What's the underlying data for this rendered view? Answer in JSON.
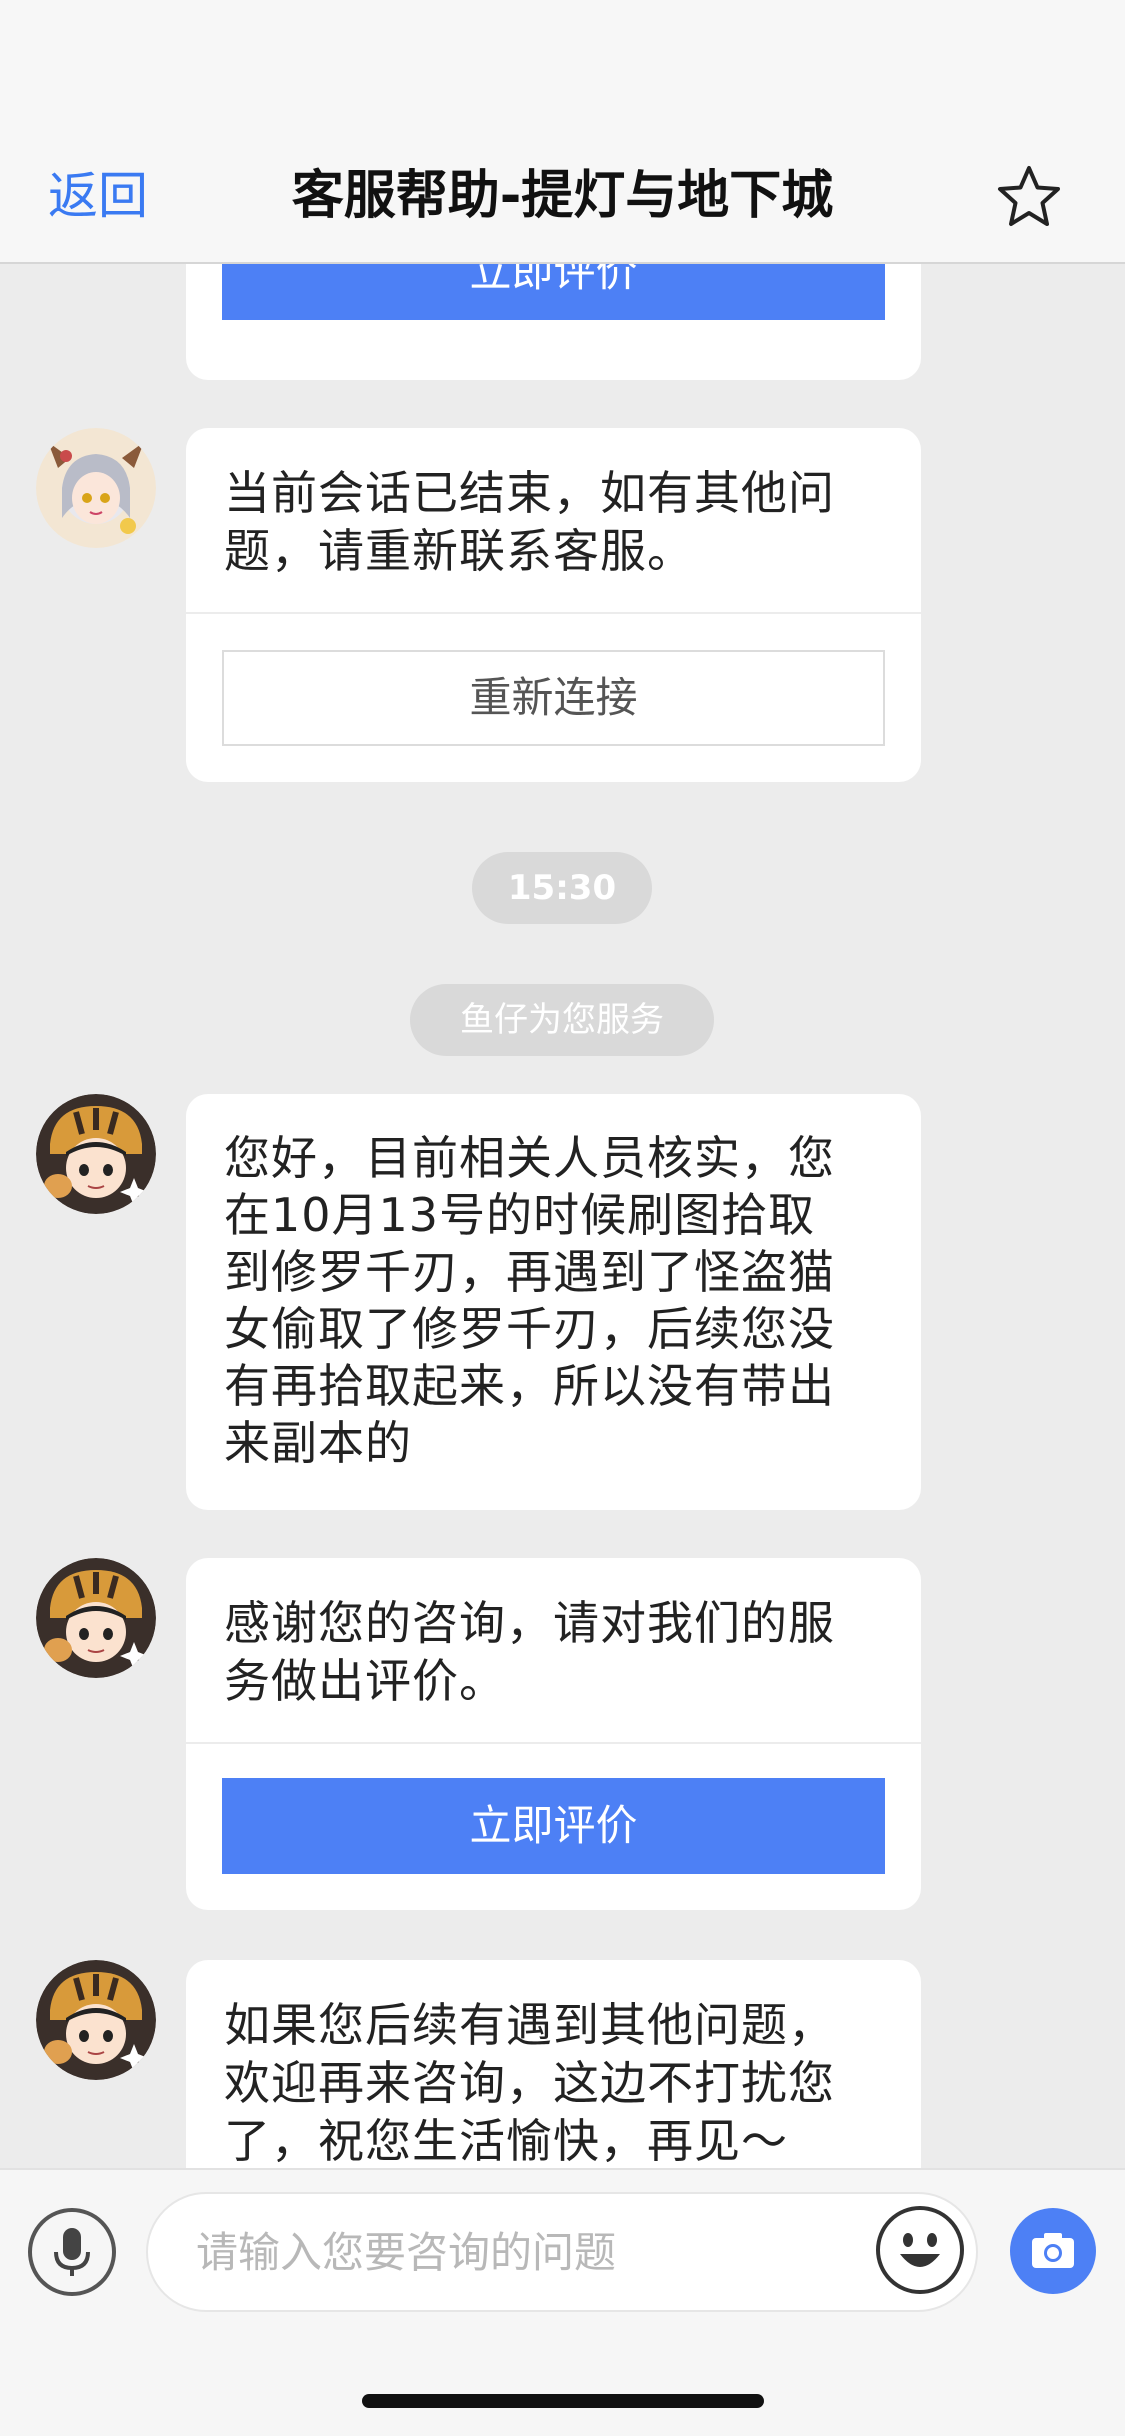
{
  "header": {
    "back_label": "返回",
    "title": "客服帮助-提灯与地下城",
    "favorite_icon": "star-icon"
  },
  "messages": [
    {
      "type": "rating_prompt_partial",
      "button_label": "立即评价"
    },
    {
      "type": "session_end",
      "avatar": "agent-avatar-girl",
      "text": "当前会话已结束，如有其他问题，请重新联系客服。",
      "button_label": "重新连接"
    },
    {
      "type": "time",
      "text": "15:30"
    },
    {
      "type": "notice",
      "text": "鱼仔为您服务"
    },
    {
      "type": "text",
      "avatar": "agent-avatar-tiger",
      "text": "您好，目前相关人员核实，您在10月13号的时候刷图拾取到修罗千刃，再遇到了怪盗猫女偷取了修罗千刃，后续您没有再拾取起来，所以没有带出来副本的"
    },
    {
      "type": "rating_prompt",
      "avatar": "agent-avatar-tiger",
      "text": "感谢您的咨询，请对我们的服务做出评价。",
      "button_label": "立即评价"
    },
    {
      "type": "text",
      "avatar": "agent-avatar-tiger",
      "text": "如果您后续有遇到其他问题，欢迎再来咨询，这边不打扰您了，祝您生活愉快，再见～"
    }
  ],
  "input_bar": {
    "placeholder": "请输入您要咨询的问题",
    "voice_icon": "microphone-icon",
    "emoji_icon": "emoji-icon",
    "camera_icon": "camera-icon"
  },
  "colors": {
    "accent": "#4d80f5",
    "link": "#3a7af2",
    "background": "#ececec"
  }
}
